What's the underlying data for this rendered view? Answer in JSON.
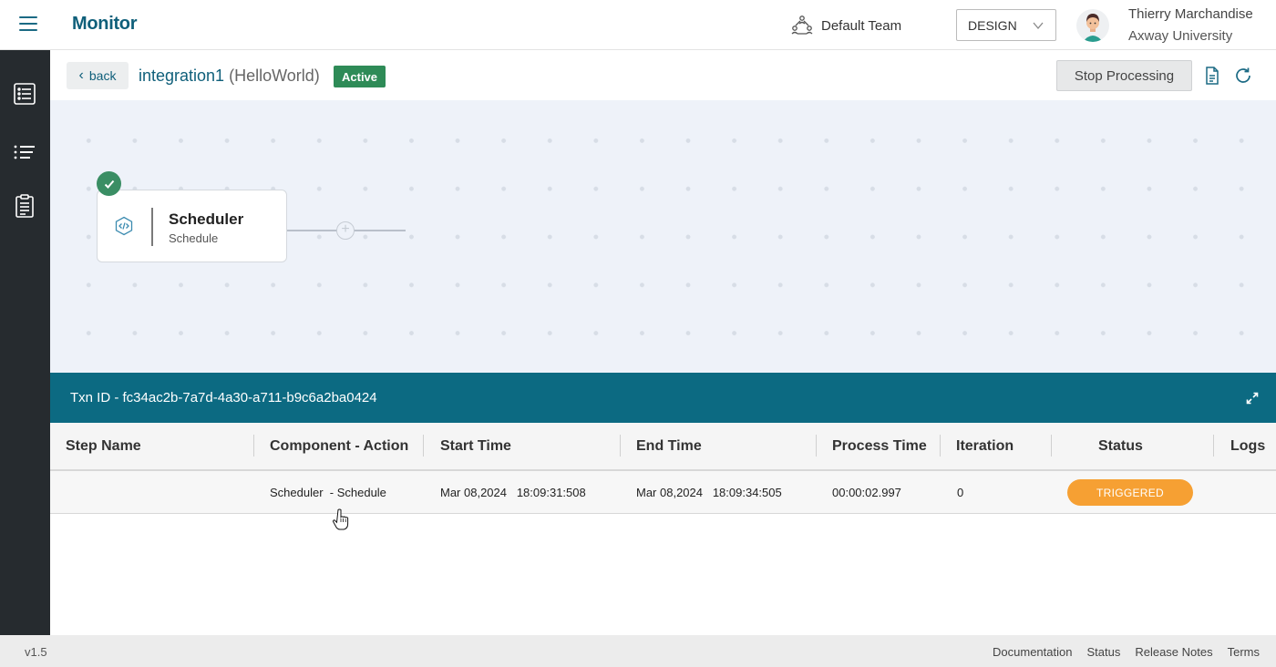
{
  "header": {
    "app_title": "Monitor",
    "team_label": "Default Team",
    "environment": "DESIGN",
    "user_name": "Thierry Marchandise",
    "user_org": "Axway University"
  },
  "subheader": {
    "back_label": "back",
    "integration_name": "integration1",
    "integration_flow": "(HelloWorld)",
    "status_badge": "Active",
    "stop_label": "Stop Processing"
  },
  "canvas": {
    "node": {
      "title": "Scheduler",
      "subtitle": "Schedule"
    }
  },
  "transaction": {
    "label": "Txn ID - fc34ac2b-7a7d-4a30-a711-b9c6a2ba0424",
    "columns": [
      "Step Name",
      "Component - Action",
      "Start Time",
      "End Time",
      "Process Time",
      "Iteration",
      "Status",
      "Logs"
    ],
    "rows": [
      {
        "step_name": "",
        "component_action": "Scheduler  - Schedule",
        "start_time": "Mar 08,2024   18:09:31:508",
        "end_time": "Mar 08,2024   18:09:34:505",
        "process_time": "00:00:02.997",
        "iteration": "0",
        "status": "TRIGGERED"
      }
    ]
  },
  "footer": {
    "version": "v1.5",
    "links": [
      "Documentation",
      "Status",
      "Release Notes",
      "Terms"
    ]
  },
  "colors": {
    "brand": "#0f5f7a",
    "txn_bar": "#0c6a82",
    "active_badge": "#2e8b57",
    "triggered": "#f6a033",
    "sidebar": "#262b2f"
  }
}
